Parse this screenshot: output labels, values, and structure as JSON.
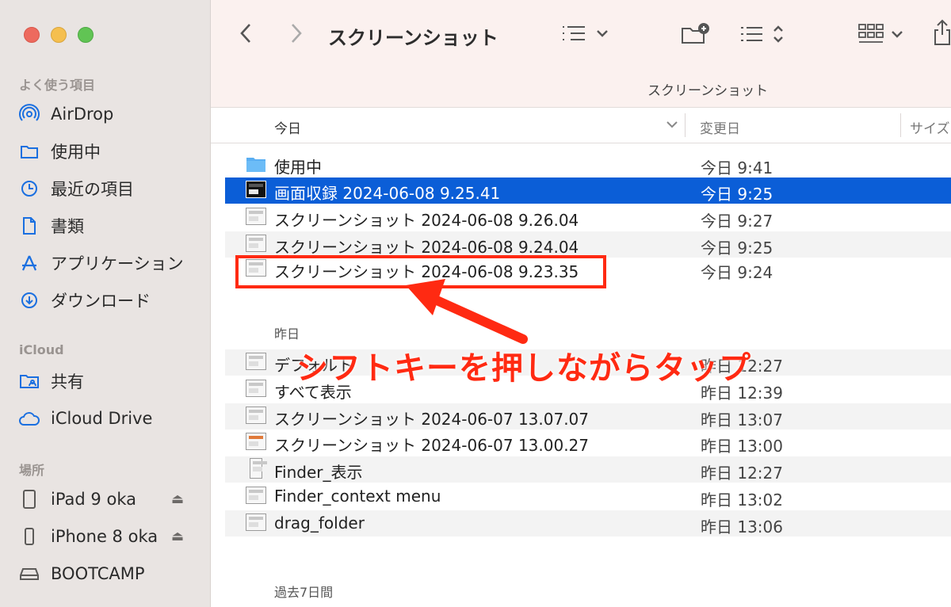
{
  "sidebar": {
    "favorites_title": "よく使う項目",
    "favorites": [
      {
        "label": "AirDrop",
        "icon": "airdrop-icon"
      },
      {
        "label": "使用中",
        "icon": "folder-icon"
      },
      {
        "label": "最近の項目",
        "icon": "clock-icon"
      },
      {
        "label": "書類",
        "icon": "document-icon"
      },
      {
        "label": "アプリケーション",
        "icon": "applications-icon"
      },
      {
        "label": "ダウンロード",
        "icon": "download-icon"
      }
    ],
    "icloud_title": "iCloud",
    "icloud": [
      {
        "label": "共有",
        "icon": "shared-folder-icon"
      },
      {
        "label": "iCloud Drive",
        "icon": "cloud-icon"
      }
    ],
    "locations_title": "場所",
    "locations": [
      {
        "label": "iPad 9 oka",
        "icon": "ipad-icon",
        "eject": "⏏"
      },
      {
        "label": "iPhone 8 oka",
        "icon": "iphone-icon",
        "eject": "⏏"
      },
      {
        "label": "BOOTCAMP",
        "icon": "drive-icon"
      }
    ]
  },
  "toolbar": {
    "title": "スクリーンショット",
    "path_label": "スクリーンショット"
  },
  "columns": {
    "name": "今日",
    "date": "変更日",
    "size": "サイズ"
  },
  "groups": {
    "yesterday": "昨日",
    "past7": "過去7日間"
  },
  "files_today": [
    {
      "name": "使用中",
      "date": "今日 9:41",
      "icon": "folder-icon"
    },
    {
      "name": "画面収録 2024-06-08 9.25.41",
      "date": "今日 9:25",
      "icon": "screen-recording-icon",
      "selected": true
    },
    {
      "name": "スクリーンショット 2024-06-08 9.26.04",
      "date": "今日 9:27",
      "icon": "image-thumbnail-icon"
    },
    {
      "name": "スクリーンショット 2024-06-08 9.24.04",
      "date": "今日 9:25",
      "icon": "image-thumbnail-icon"
    },
    {
      "name": "スクリーンショット 2024-06-08 9.23.35",
      "date": "今日 9:24",
      "icon": "image-thumbnail-icon"
    }
  ],
  "files_yesterday": [
    {
      "name": "デフォルト",
      "date": "昨日 12:27",
      "icon": "image-thumbnail-icon"
    },
    {
      "name": "すべて表示",
      "date": "昨日 12:39",
      "icon": "image-thumbnail-icon"
    },
    {
      "name": "スクリーンショット 2024-06-07 13.07.07",
      "date": "昨日 13:07",
      "icon": "image-thumbnail-icon"
    },
    {
      "name": "スクリーンショット 2024-06-07 13.00.27",
      "date": "昨日 13:00",
      "icon": "image-thumbnail-icon"
    },
    {
      "name": "Finder_表示",
      "date": "昨日 12:27",
      "icon": "image-thumbnail-icon"
    },
    {
      "name": "Finder_context menu",
      "date": "昨日 13:02",
      "icon": "image-thumbnail-icon"
    },
    {
      "name": "drag_folder",
      "date": "昨日 13:06",
      "icon": "image-thumbnail-icon"
    }
  ],
  "annotation": {
    "text": "シフトキーを押しながらタップ",
    "color": "#ff2a12"
  },
  "colors": {
    "selection": "#0b5ed7",
    "accent_icon": "#1a6fe0",
    "folder": "#5aaef2"
  }
}
